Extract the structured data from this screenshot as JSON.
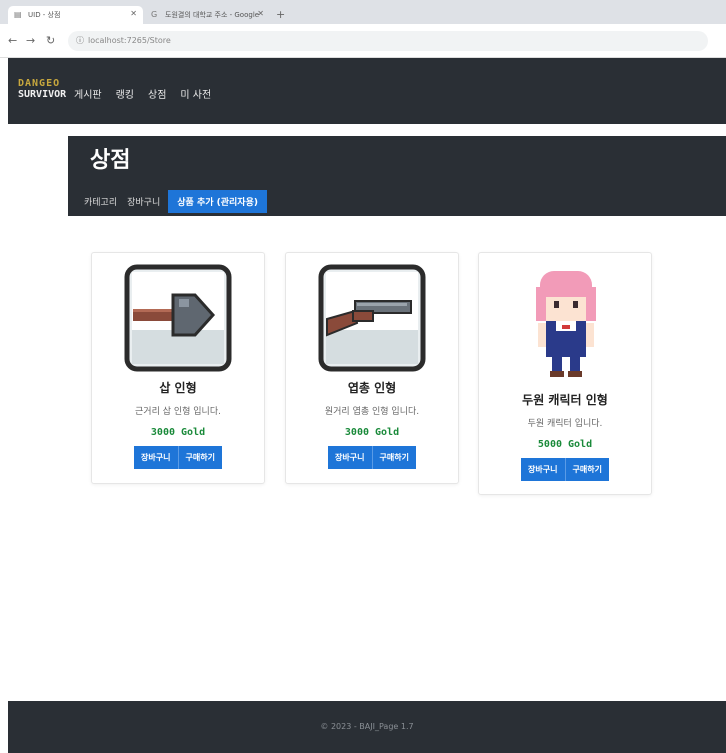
{
  "browser": {
    "active_tab_title": "UID - 상점",
    "inactive_tab_title": "도원결의 대학교 주소 - Google",
    "url": "localhost:7265/Store",
    "new_tab_label": "+"
  },
  "site": {
    "logo_line1": "DANGEO",
    "logo_line2": "SURVIVOR",
    "menu": [
      {
        "label": "게시판"
      },
      {
        "label": "랭킹"
      },
      {
        "label": "상점"
      },
      {
        "label": "미 사전"
      }
    ]
  },
  "page": {
    "title": "상점",
    "subnav": {
      "category": "카테고리",
      "cart": "장바구니",
      "add_product": "상품 추가 (관리자용)"
    }
  },
  "products": [
    {
      "name": "삽 인형",
      "desc": "근거리 삽 인형 입니다.",
      "price": "3000 Gold",
      "cart_label": "장바구니",
      "buy_label": "구매하기",
      "icon": "shovel-icon"
    },
    {
      "name": "엽총 인형",
      "desc": "원거리 엽총 인형 입니다.",
      "price": "3000 Gold",
      "cart_label": "장바구니",
      "buy_label": "구매하기",
      "icon": "shotgun-icon"
    },
    {
      "name": "두원 캐릭터 인형",
      "desc": "두원 캐릭터 입니다.",
      "price": "5000 Gold",
      "cart_label": "장바구니",
      "buy_label": "구매하기",
      "icon": "pink-hair-character-icon"
    }
  ],
  "footer": {
    "text": "© 2023 - BAJI_Page 1.7"
  },
  "colors": {
    "navbar_bg": "#2a2f35",
    "accent_blue": "#1e75d8",
    "price_green": "#1a8a3a"
  }
}
